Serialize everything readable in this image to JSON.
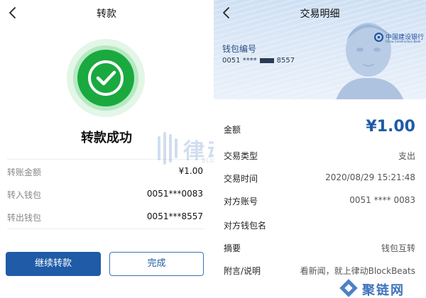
{
  "left": {
    "title": "转款",
    "status": "转款成功",
    "rows": [
      {
        "label": "转账金额",
        "value": "¥1.00"
      },
      {
        "label": "转入钱包",
        "value": "0051***0083"
      },
      {
        "label": "转出钱包",
        "value": "0051***8557"
      }
    ],
    "buttons": {
      "continue": "继续转款",
      "done": "完成"
    },
    "colors": {
      "success": "#19a93f",
      "primary": "#1f5ba6"
    }
  },
  "watermark": {
    "cn": "律动",
    "en": "BLOCKBEATS"
  },
  "right": {
    "title": "交易明细",
    "bank": {
      "cn": "中国建设银行",
      "en": "China Construction Bank"
    },
    "wallet": {
      "label": "钱包编号",
      "number_prefix": "0051 ****",
      "number_suffix": "8557"
    },
    "amount": {
      "label": "金额",
      "value": "¥1.00"
    },
    "rows": [
      {
        "label": "交易类型",
        "value": "支出"
      },
      {
        "label": "交易时间",
        "value": "2020/08/29 15:21:48"
      },
      {
        "label": "对方账号",
        "value": "0051 **** 0083"
      },
      {
        "label": "对方钱包名",
        "value": ""
      },
      {
        "label": "摘要",
        "value": "钱包互转"
      },
      {
        "label": "附言/说明",
        "value": "看新闻，就上律动BlockBeats"
      }
    ]
  },
  "corner_logo": {
    "text": "聚链网"
  },
  "icons": {
    "back": "chevron-left-icon",
    "success": "checkmark-circle-icon"
  }
}
